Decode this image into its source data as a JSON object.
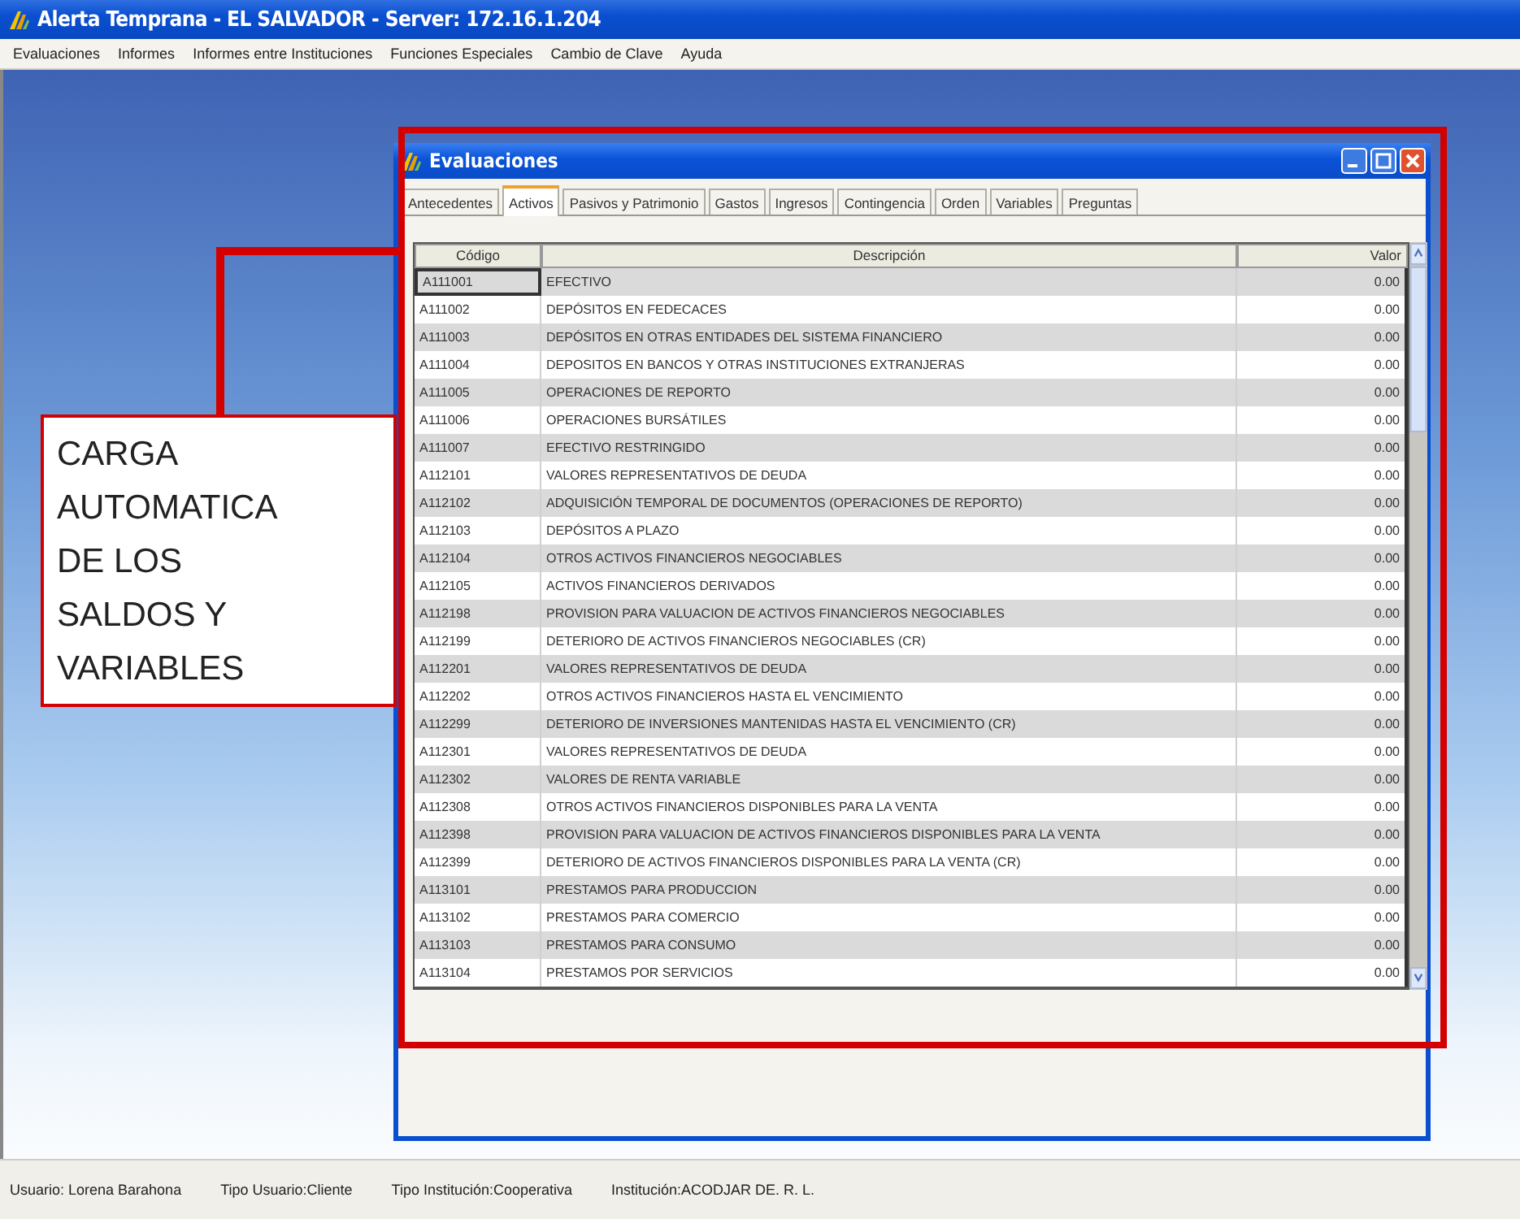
{
  "window": {
    "title": "Alerta Temprana - EL SALVADOR - Server: 172.16.1.204"
  },
  "menu": [
    "Evaluaciones",
    "Informes",
    "Informes entre Instituciones",
    "Funciones Especiales",
    "Cambio de Clave",
    "Ayuda"
  ],
  "child_window": {
    "title": "Evaluaciones",
    "tabs": [
      {
        "label": "Antecedentes",
        "selected": false
      },
      {
        "label": "Activos",
        "selected": true
      },
      {
        "label": "Pasivos y Patrimonio",
        "selected": false
      },
      {
        "label": "Gastos",
        "selected": false
      },
      {
        "label": "Ingresos",
        "selected": false
      },
      {
        "label": "Contingencia",
        "selected": false
      },
      {
        "label": "Orden",
        "selected": false
      },
      {
        "label": "Variables",
        "selected": false
      },
      {
        "label": "Preguntas",
        "selected": false
      }
    ],
    "table": {
      "columns": [
        "Código",
        "Descripción",
        "Valor"
      ],
      "rows": [
        {
          "code": "A111001",
          "description": "EFECTIVO",
          "value": "0.00",
          "selected": true
        },
        {
          "code": "A111002",
          "description": "DEPÓSITOS EN FEDECACES",
          "value": "0.00",
          "selected": false
        },
        {
          "code": "A111003",
          "description": "DEPÓSITOS EN OTRAS ENTIDADES DEL SISTEMA FINANCIERO",
          "value": "0.00",
          "selected": false
        },
        {
          "code": "A111004",
          "description": "DEPOSITOS EN BANCOS Y OTRAS INSTITUCIONES EXTRANJERAS",
          "value": "0.00",
          "selected": false
        },
        {
          "code": "A111005",
          "description": "OPERACIONES DE REPORTO",
          "value": "0.00",
          "selected": false
        },
        {
          "code": "A111006",
          "description": "OPERACIONES BURSÁTILES",
          "value": "0.00",
          "selected": false
        },
        {
          "code": "A111007",
          "description": "EFECTIVO RESTRINGIDO",
          "value": "0.00",
          "selected": false
        },
        {
          "code": "A112101",
          "description": "VALORES REPRESENTATIVOS DE DEUDA",
          "value": "0.00",
          "selected": false
        },
        {
          "code": "A112102",
          "description": "ADQUISICIÓN TEMPORAL DE DOCUMENTOS (OPERACIONES DE REPORTO)",
          "value": "0.00",
          "selected": false
        },
        {
          "code": "A112103",
          "description": "DEPÓSITOS A PLAZO",
          "value": "0.00",
          "selected": false
        },
        {
          "code": "A112104",
          "description": "OTROS ACTIVOS FINANCIEROS NEGOCIABLES",
          "value": "0.00",
          "selected": false
        },
        {
          "code": "A112105",
          "description": "ACTIVOS FINANCIEROS DERIVADOS",
          "value": "0.00",
          "selected": false
        },
        {
          "code": "A112198",
          "description": "PROVISION PARA VALUACION DE ACTIVOS FINANCIEROS NEGOCIABLES",
          "value": "0.00",
          "selected": false
        },
        {
          "code": "A112199",
          "description": "DETERIORO DE ACTIVOS FINANCIEROS NEGOCIABLES (CR)",
          "value": "0.00",
          "selected": false
        },
        {
          "code": "A112201",
          "description": "VALORES REPRESENTATIVOS DE DEUDA",
          "value": "0.00",
          "selected": false
        },
        {
          "code": "A112202",
          "description": "OTROS ACTIVOS FINANCIEROS HASTA EL VENCIMIENTO",
          "value": "0.00",
          "selected": false
        },
        {
          "code": "A112299",
          "description": "DETERIORO DE INVERSIONES MANTENIDAS HASTA EL VENCIMIENTO (CR)",
          "value": "0.00",
          "selected": false
        },
        {
          "code": "A112301",
          "description": "VALORES REPRESENTATIVOS DE DEUDA",
          "value": "0.00",
          "selected": false
        },
        {
          "code": "A112302",
          "description": "VALORES DE RENTA VARIABLE",
          "value": "0.00",
          "selected": false
        },
        {
          "code": "A112308",
          "description": "OTROS ACTIVOS FINANCIEROS DISPONIBLES PARA LA VENTA",
          "value": "0.00",
          "selected": false
        },
        {
          "code": "A112398",
          "description": "PROVISION PARA VALUACION DE ACTIVOS FINANCIEROS DISPONIBLES PARA LA VENTA",
          "value": "0.00",
          "selected": false
        },
        {
          "code": "A112399",
          "description": "DETERIORO DE ACTIVOS FINANCIEROS DISPONIBLES PARA LA VENTA (CR)",
          "value": "0.00",
          "selected": false
        },
        {
          "code": "A113101",
          "description": "PRESTAMOS PARA PRODUCCION",
          "value": "0.00",
          "selected": false
        },
        {
          "code": "A113102",
          "description": "PRESTAMOS PARA COMERCIO",
          "value": "0.00",
          "selected": false
        },
        {
          "code": "A113103",
          "description": "PRESTAMOS PARA CONSUMO",
          "value": "0.00",
          "selected": false
        },
        {
          "code": "A113104",
          "description": "PRESTAMOS POR SERVICIOS",
          "value": "0.00",
          "selected": false
        }
      ]
    }
  },
  "callout": {
    "text": "CARGA\nAUTOMATICA\nDE LOS\nSALDOS Y\nVARIABLES"
  },
  "status_bar": [
    "Usuario: Lorena Barahona",
    "Tipo Usuario:Cliente",
    "Tipo Institución:Cooperativa",
    "Institución:ACODJAR DE. R. L."
  ]
}
